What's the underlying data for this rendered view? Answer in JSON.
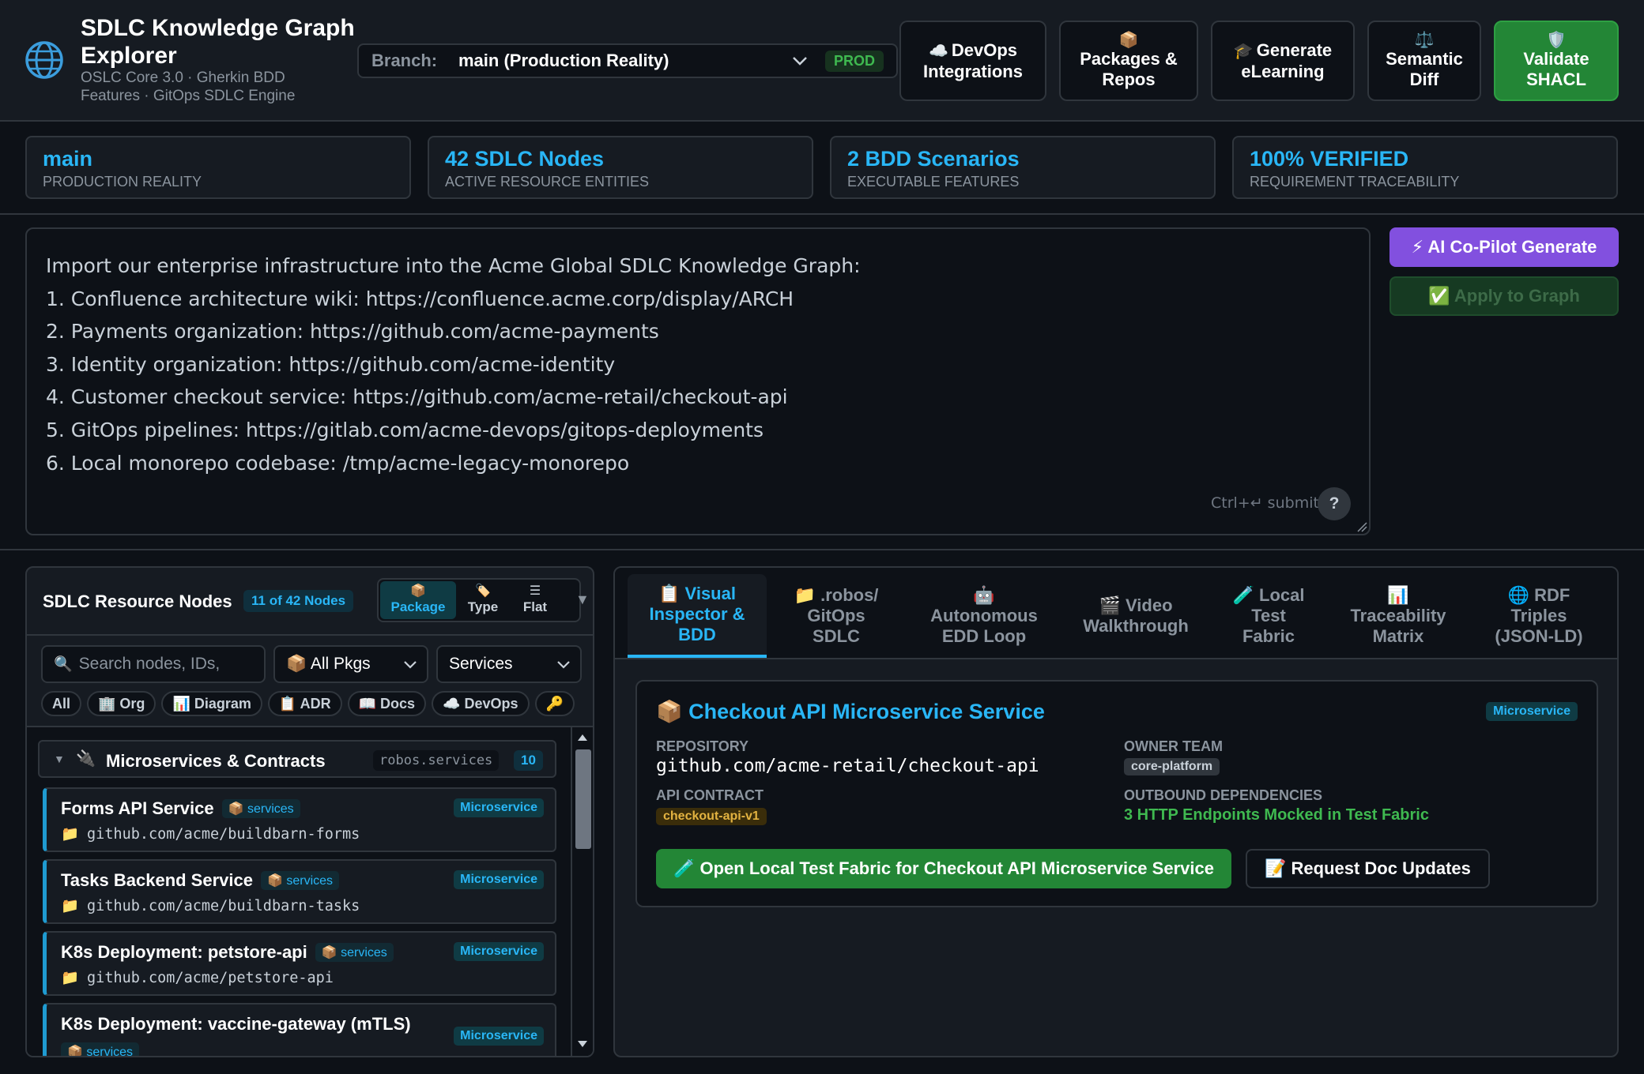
{
  "header": {
    "title": "SDLC Knowledge Graph Explorer",
    "subtitle": "OSLC Core 3.0 · Gherkin BDD Features · GitOps SDLC Engine",
    "branch_label": "Branch:",
    "branch_value": "main (Production Reality)",
    "branch_badge": "PROD",
    "buttons": {
      "devops": {
        "icon": "☁️",
        "label": "DevOps Integrations"
      },
      "packages": {
        "icon": "📦",
        "label": "Packages & Repos"
      },
      "elearning": {
        "icon": "🎓",
        "label": "Generate eLearning"
      },
      "diff": {
        "icon": "⚖️",
        "label": "Semantic Diff"
      },
      "shacl": {
        "icon": "🛡️",
        "label": "Validate SHACL"
      }
    }
  },
  "stats": [
    {
      "value": "main",
      "label": "PRODUCTION REALITY"
    },
    {
      "value": "42 SDLC Nodes",
      "label": "ACTIVE RESOURCE ENTITIES"
    },
    {
      "value": "2 BDD Scenarios",
      "label": "EXECUTABLE FEATURES"
    },
    {
      "value": "100% VERIFIED",
      "label": "REQUIREMENT TRACEABILITY"
    }
  ],
  "prompt": {
    "lines": [
      "Import our enterprise infrastructure into the Acme Global SDLC Knowledge Graph:",
      "1. Confluence architecture wiki: https://confluence.acme.corp/display/ARCH",
      "2. Payments organization: https://github.com/acme-payments",
      "3. Identity organization: https://github.com/acme-identity",
      "4. Customer checkout service: https://github.com/acme-retail/checkout-api",
      "5. GitOps pipelines: https://gitlab.com/acme-devops/gitops-deployments",
      "6. Local monorepo codebase: /tmp/acme-legacy-monorepo"
    ],
    "submit_hint": "Ctrl+↵ submit",
    "help": "?",
    "ai_button": "⚡ AI Co-Pilot Generate",
    "apply_button": "✅ Apply to Graph"
  },
  "left_panel": {
    "title": "SDLC Resource Nodes",
    "count": "11 of 42 Nodes",
    "views": [
      {
        "icon": "📦",
        "label": "Package"
      },
      {
        "icon": "🏷️",
        "label": "Type"
      },
      {
        "icon": "☰",
        "label": "Flat"
      }
    ],
    "collapse": "▼",
    "search_placeholder": "Search nodes, IDs,",
    "pkg_select": "📦 All Pkgs",
    "type_select": "Services",
    "chips": [
      "All",
      "🏢 Org",
      "📊 Diagram",
      "📋 ADR",
      "📖 Docs",
      "☁️ DevOps",
      "🔑"
    ],
    "group": {
      "caret": "▼",
      "icon": "🔌",
      "title": "Microservices & Contracts",
      "namespace": "robos.services",
      "count": "10"
    },
    "items": [
      {
        "title": "Forms API Service",
        "pkg": "📦 services",
        "type": "Microservice",
        "path": "github.com/acme/buildbarn-forms"
      },
      {
        "title": "Tasks Backend Service",
        "pkg": "📦 services",
        "type": "Microservice",
        "path": "github.com/acme/buildbarn-tasks"
      },
      {
        "title": "K8s Deployment: petstore-api",
        "pkg": "📦 services",
        "type": "Microservice",
        "path": "github.com/acme/petstore-api"
      },
      {
        "title": "K8s Deployment: vaccine-gateway (mTLS)",
        "pkg": "📦 services",
        "type": "Microservice",
        "path": ""
      }
    ],
    "folder_icon": "📁"
  },
  "right_panel": {
    "tabs": [
      {
        "icon": "📋",
        "label": "Visual Inspector & BDD"
      },
      {
        "icon": "📁",
        "label": ".robos/ GitOps SDLC"
      },
      {
        "icon": "🤖",
        "label": "Autonomous EDD Loop"
      },
      {
        "icon": "🎬",
        "label": "Video Walkthrough"
      },
      {
        "icon": "🧪",
        "label": "Local Test Fabric"
      },
      {
        "icon": "📊",
        "label": "Traceability Matrix"
      },
      {
        "icon": "🌐",
        "label": "RDF Triples (JSON-LD)"
      }
    ],
    "detail": {
      "icon": "📦",
      "title": "Checkout API Microservice Service",
      "badge": "Microservice",
      "repo_label": "REPOSITORY",
      "repo_value": "github.com/acme-retail/checkout-api",
      "owner_label": "OWNER TEAM",
      "owner_value": "core-platform",
      "api_label": "API CONTRACT",
      "api_value": "checkout-api-v1",
      "deps_label": "OUTBOUND DEPENDENCIES",
      "deps_value": "3 HTTP Endpoints Mocked in Test Fabric",
      "fabric_button": "🧪 Open Local Test Fabric for Checkout API Microservice Service",
      "docs_button": "📝 Request Doc Updates"
    }
  },
  "colors": {
    "accent": "#29b6f6",
    "success": "#238636",
    "ai": "#8250df",
    "background": "#0d1117",
    "surface": "#161b22"
  }
}
